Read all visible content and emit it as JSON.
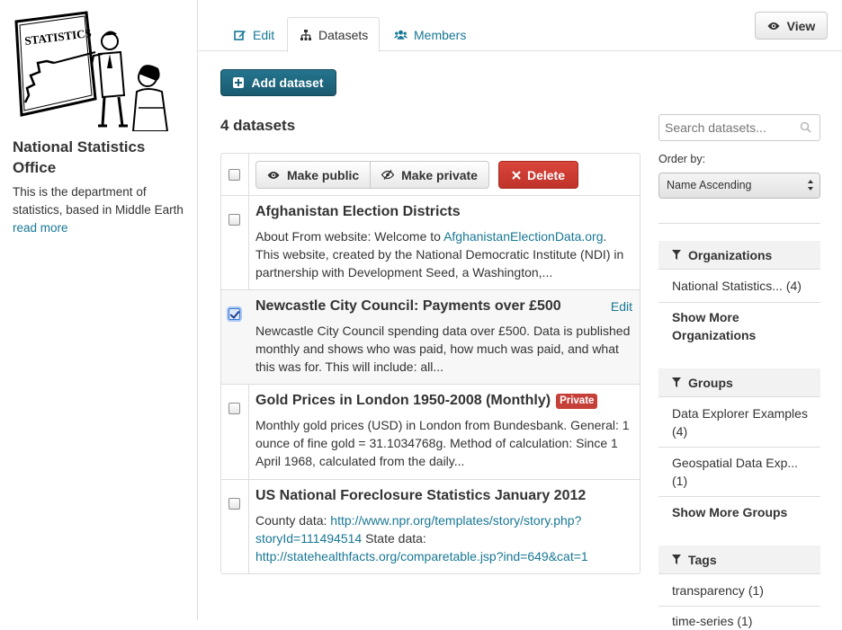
{
  "org": {
    "title": "National Statistics Office",
    "description": "This is the department of statistics, based in Middle Earth",
    "read_more": "read more",
    "logo_text": "STATISTICS"
  },
  "tabs": [
    {
      "label": "Edit",
      "icon": "edit-icon"
    },
    {
      "label": "Datasets",
      "icon": "sitemap-icon"
    },
    {
      "label": "Members",
      "icon": "group-icon"
    }
  ],
  "view_button": "View",
  "add_dataset": "Add dataset",
  "dataset_count": "4 datasets",
  "bulk": {
    "make_public": "Make public",
    "make_private": "Make private",
    "delete": "Delete"
  },
  "datasets": [
    {
      "title": "Afghanistan Election Districts",
      "desc_prefix": "About From website: Welcome to ",
      "desc_link": "AfghanistanElectionData.org",
      "desc_suffix": ". This website, created by the National Democratic Institute (NDI) in partnership with Development Seed, a Washington,...",
      "checked": false
    },
    {
      "title": "Newcastle City Council: Payments over £500",
      "description": "Newcastle City Council spending data over £500. Data is published monthly and shows who was paid, how much was paid, and what this was for. This will include: all...",
      "edit": "Edit",
      "checked": true
    },
    {
      "title": "Gold Prices in London 1950-2008 (Monthly)",
      "badge": "Private",
      "description": "Monthly gold prices (USD) in London from Bundesbank. General: 1 ounce of fine gold = 31.1034768g. Method of calculation: Since 1 April 1968, calculated from the daily...",
      "checked": false
    },
    {
      "title": "US National Foreclosure Statistics January 2012",
      "desc_prefix": "County data: ",
      "desc_link1": "http://www.npr.org/templates/story/story.php?storyId=111494514",
      "desc_mid": " State data: ",
      "desc_link2": "http://statehealthfacts.org/comparetable.jsp?ind=649&cat=1",
      "checked": false
    }
  ],
  "search": {
    "placeholder": "Search datasets..."
  },
  "order": {
    "label": "Order by:",
    "selected": "Name Ascending"
  },
  "facets": {
    "organizations": {
      "title": "Organizations",
      "items": [
        "National Statistics... (4)"
      ],
      "more": "Show More Organizations"
    },
    "groups": {
      "title": "Groups",
      "items": [
        "Data Explorer Examples (4)",
        "Geospatial Data Exp... (1)"
      ],
      "more": "Show More Groups"
    },
    "tags": {
      "title": "Tags",
      "items": [
        "transparency (1)",
        "time-series (1)"
      ]
    }
  },
  "colors": {
    "link": "#187794",
    "primary": "#1d6279",
    "danger": "#c9372e",
    "border": "#dddddd"
  }
}
